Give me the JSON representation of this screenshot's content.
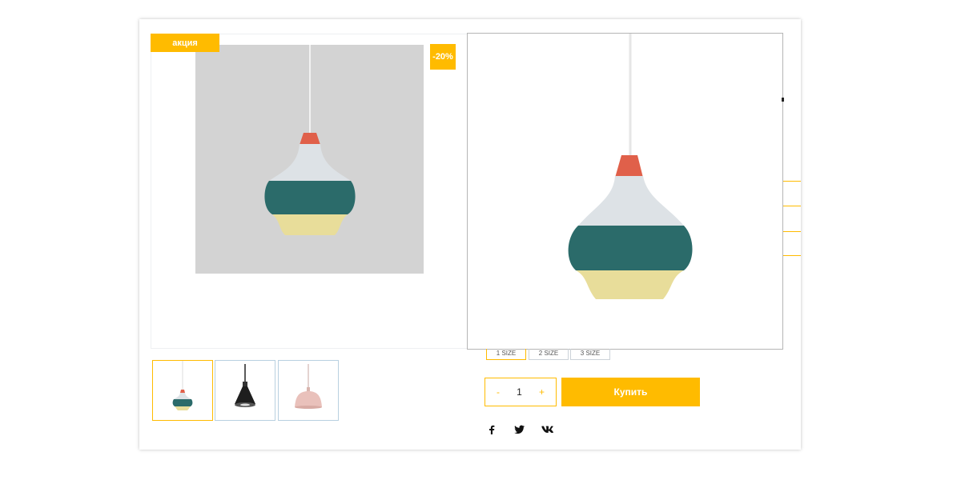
{
  "colors": {
    "accent": "#ffbb00",
    "lamp_top": "#dde2e6",
    "lamp_neck": "#e0604a",
    "lamp_body": "#2b6b6a",
    "lamp_base": "#e8dd9a",
    "image_bg": "#d3d3d3"
  },
  "badges": {
    "sale": "акция",
    "discount": "-20%"
  },
  "gallery": {
    "thumbnails": [
      {
        "name": "teal-pendant-lamp",
        "active": true
      },
      {
        "name": "black-pendant-lamp",
        "active": false
      },
      {
        "name": "pink-pendant-lamp",
        "active": false
      }
    ]
  },
  "sizes": [
    "1 SIZE",
    "2 SIZE",
    "3 SIZE"
  ],
  "quantity": {
    "minus": "-",
    "value": "1",
    "plus": "+"
  },
  "buy_label": "Купить",
  "social": {
    "facebook": "f",
    "twitter": "twitter-icon",
    "vk": "vk-icon"
  }
}
